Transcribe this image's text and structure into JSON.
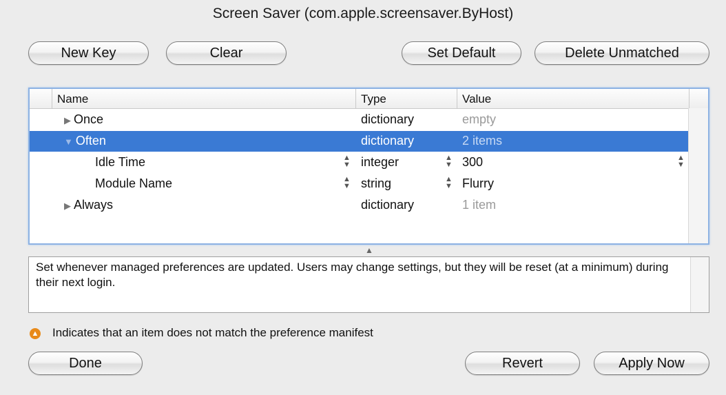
{
  "window": {
    "title": "Screen Saver (com.apple.screensaver.ByHost)"
  },
  "toolbar": {
    "new_key": "New Key",
    "clear": "Clear",
    "set_default": "Set Default",
    "delete_unmatched": "Delete Unmatched"
  },
  "table": {
    "headers": {
      "name": "Name",
      "type": "Type",
      "value": "Value"
    },
    "rows": [
      {
        "name": "Once",
        "type": "dictionary",
        "value": "empty",
        "level": 0,
        "expandable": true,
        "selected": false,
        "value_dim": true
      },
      {
        "name": "Often",
        "type": "dictionary",
        "value": "2 items",
        "level": 0,
        "expandable": true,
        "selected": true,
        "value_dim": true
      },
      {
        "name": "Idle Time",
        "type": "integer",
        "value": "300",
        "level": 1,
        "expandable": false,
        "selected": false,
        "value_dim": false
      },
      {
        "name": "Module Name",
        "type": "string",
        "value": "Flurry",
        "level": 1,
        "expandable": false,
        "selected": false,
        "value_dim": false
      },
      {
        "name": "Always",
        "type": "dictionary",
        "value": "1 item",
        "level": 0,
        "expandable": true,
        "selected": false,
        "value_dim": true
      }
    ]
  },
  "description": "Set whenever managed preferences are updated. Users may change settings, but they will be reset (at a minimum) during their next login.",
  "legend": {
    "text": "Indicates that an item does not match the preference manifest",
    "icon": "warning-icon",
    "color": "#e88a1a"
  },
  "footer": {
    "done": "Done",
    "revert": "Revert",
    "apply_now": "Apply Now"
  },
  "colors": {
    "selection": "#3a7ad4",
    "focus_ring": "#8db2e3"
  }
}
